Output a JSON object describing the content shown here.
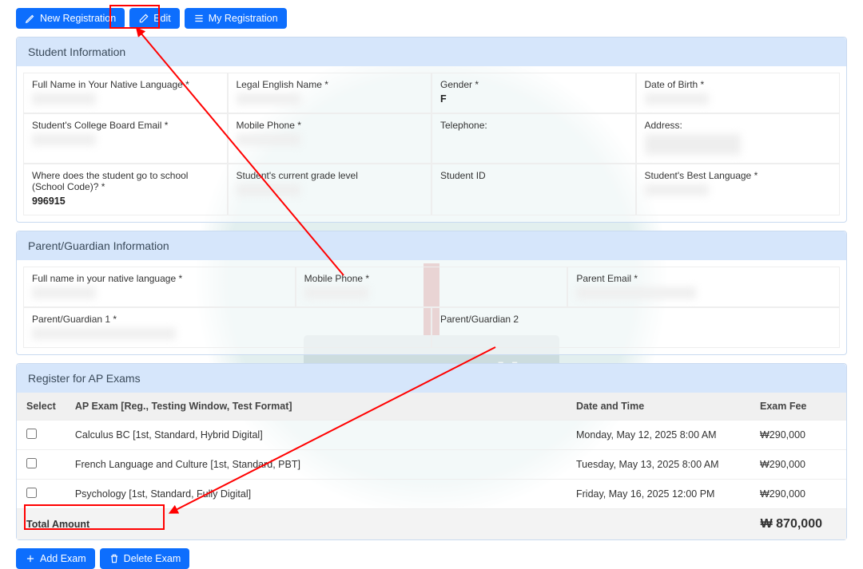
{
  "watermark_text": "TestDaily",
  "toolbar": {
    "new_reg": "New Registration",
    "edit": "Edit",
    "my_reg": "My Registration"
  },
  "student_info": {
    "header": "Student Information",
    "fields": {
      "full_name_label": "Full Name in Your Native Language *",
      "legal_name_label": "Legal English Name *",
      "gender_label": "Gender *",
      "gender_value": "F",
      "dob_label": "Date of Birth *",
      "email_label": "Student's College Board Email *",
      "mobile_label": "Mobile Phone *",
      "telephone_label": "Telephone:",
      "address_label": "Address:",
      "school_code_label": "Where does the student go to school (School Code)? *",
      "school_code_value": "996915",
      "grade_label": "Student's current grade level",
      "student_id_label": "Student ID",
      "best_lang_label": "Student's Best Language *"
    }
  },
  "parent_info": {
    "header": "Parent/Guardian Information",
    "fields": {
      "full_name_label": "Full name in your native language *",
      "mobile_label": "Mobile Phone *",
      "email_label": "Parent Email *",
      "guardian1_label": "Parent/Guardian 1 *",
      "guardian2_label": "Parent/Guardian 2"
    }
  },
  "exam_section": {
    "header": "Register for AP Exams",
    "cols": {
      "select": "Select",
      "exam": "AP Exam [Reg., Testing Window, Test Format]",
      "datetime": "Date and Time",
      "fee": "Exam Fee"
    },
    "rows": [
      {
        "exam": "Calculus BC [1st, Standard, Hybrid Digital]",
        "datetime": "Monday, May 12, 2025 8:00 AM",
        "fee": "₩290,000"
      },
      {
        "exam": "French Language and Culture [1st, Standard, PBT]",
        "datetime": "Tuesday, May 13, 2025 8:00 AM",
        "fee": "₩290,000"
      },
      {
        "exam": "Psychology [1st, Standard, Fully Digital]",
        "datetime": "Friday, May 16, 2025 12:00 PM",
        "fee": "₩290,000"
      }
    ],
    "total_label": "Total Amount",
    "total_value": "₩ 870,000",
    "add_exam": "Add Exam",
    "delete_exam": "Delete Exam"
  }
}
